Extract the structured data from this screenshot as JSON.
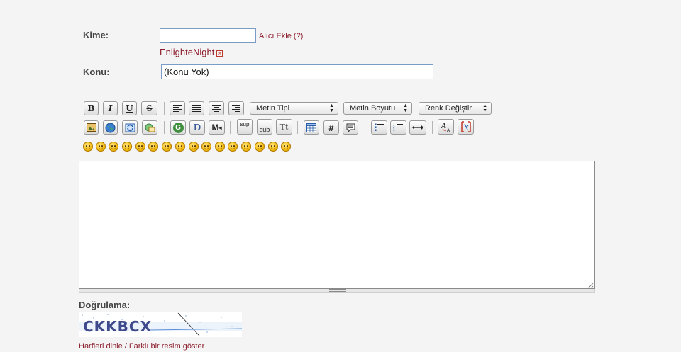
{
  "form": {
    "to_label": "Kime:",
    "to_value": "",
    "add_recipient_link": "Alıcı Ekle (?)",
    "recipient_name": "EnlighteNight",
    "subject_label": "Konu:",
    "subject_value": "(Konu Yok)"
  },
  "toolbar": {
    "bold": "B",
    "italic": "I",
    "underline": "U",
    "strike": "S",
    "font_select": "Metin Tipi",
    "size_select": "Metin Boyutu",
    "color_select": "Renk Değiştir",
    "sup": "sup",
    "sub": "sub",
    "tt": "Tt",
    "hash": "#",
    "google": "G",
    "dictionary": "D",
    "more": "M"
  },
  "smileys": [
    "smile",
    "grin",
    "big-grin",
    "laugh",
    "angry",
    "frown",
    "confused",
    "cool",
    "wink",
    "dizzy",
    "tongue",
    "eek",
    "embarrassed",
    "cry",
    "shy",
    "mad",
    "sick"
  ],
  "captcha": {
    "label": "Doğrulama:",
    "image_text": "CKKBCX",
    "links": "Harfleri dinle / Farklı bir resim göster"
  },
  "colors": {
    "link_red": "#8b1c2a",
    "field_border": "#7a9cc6"
  }
}
